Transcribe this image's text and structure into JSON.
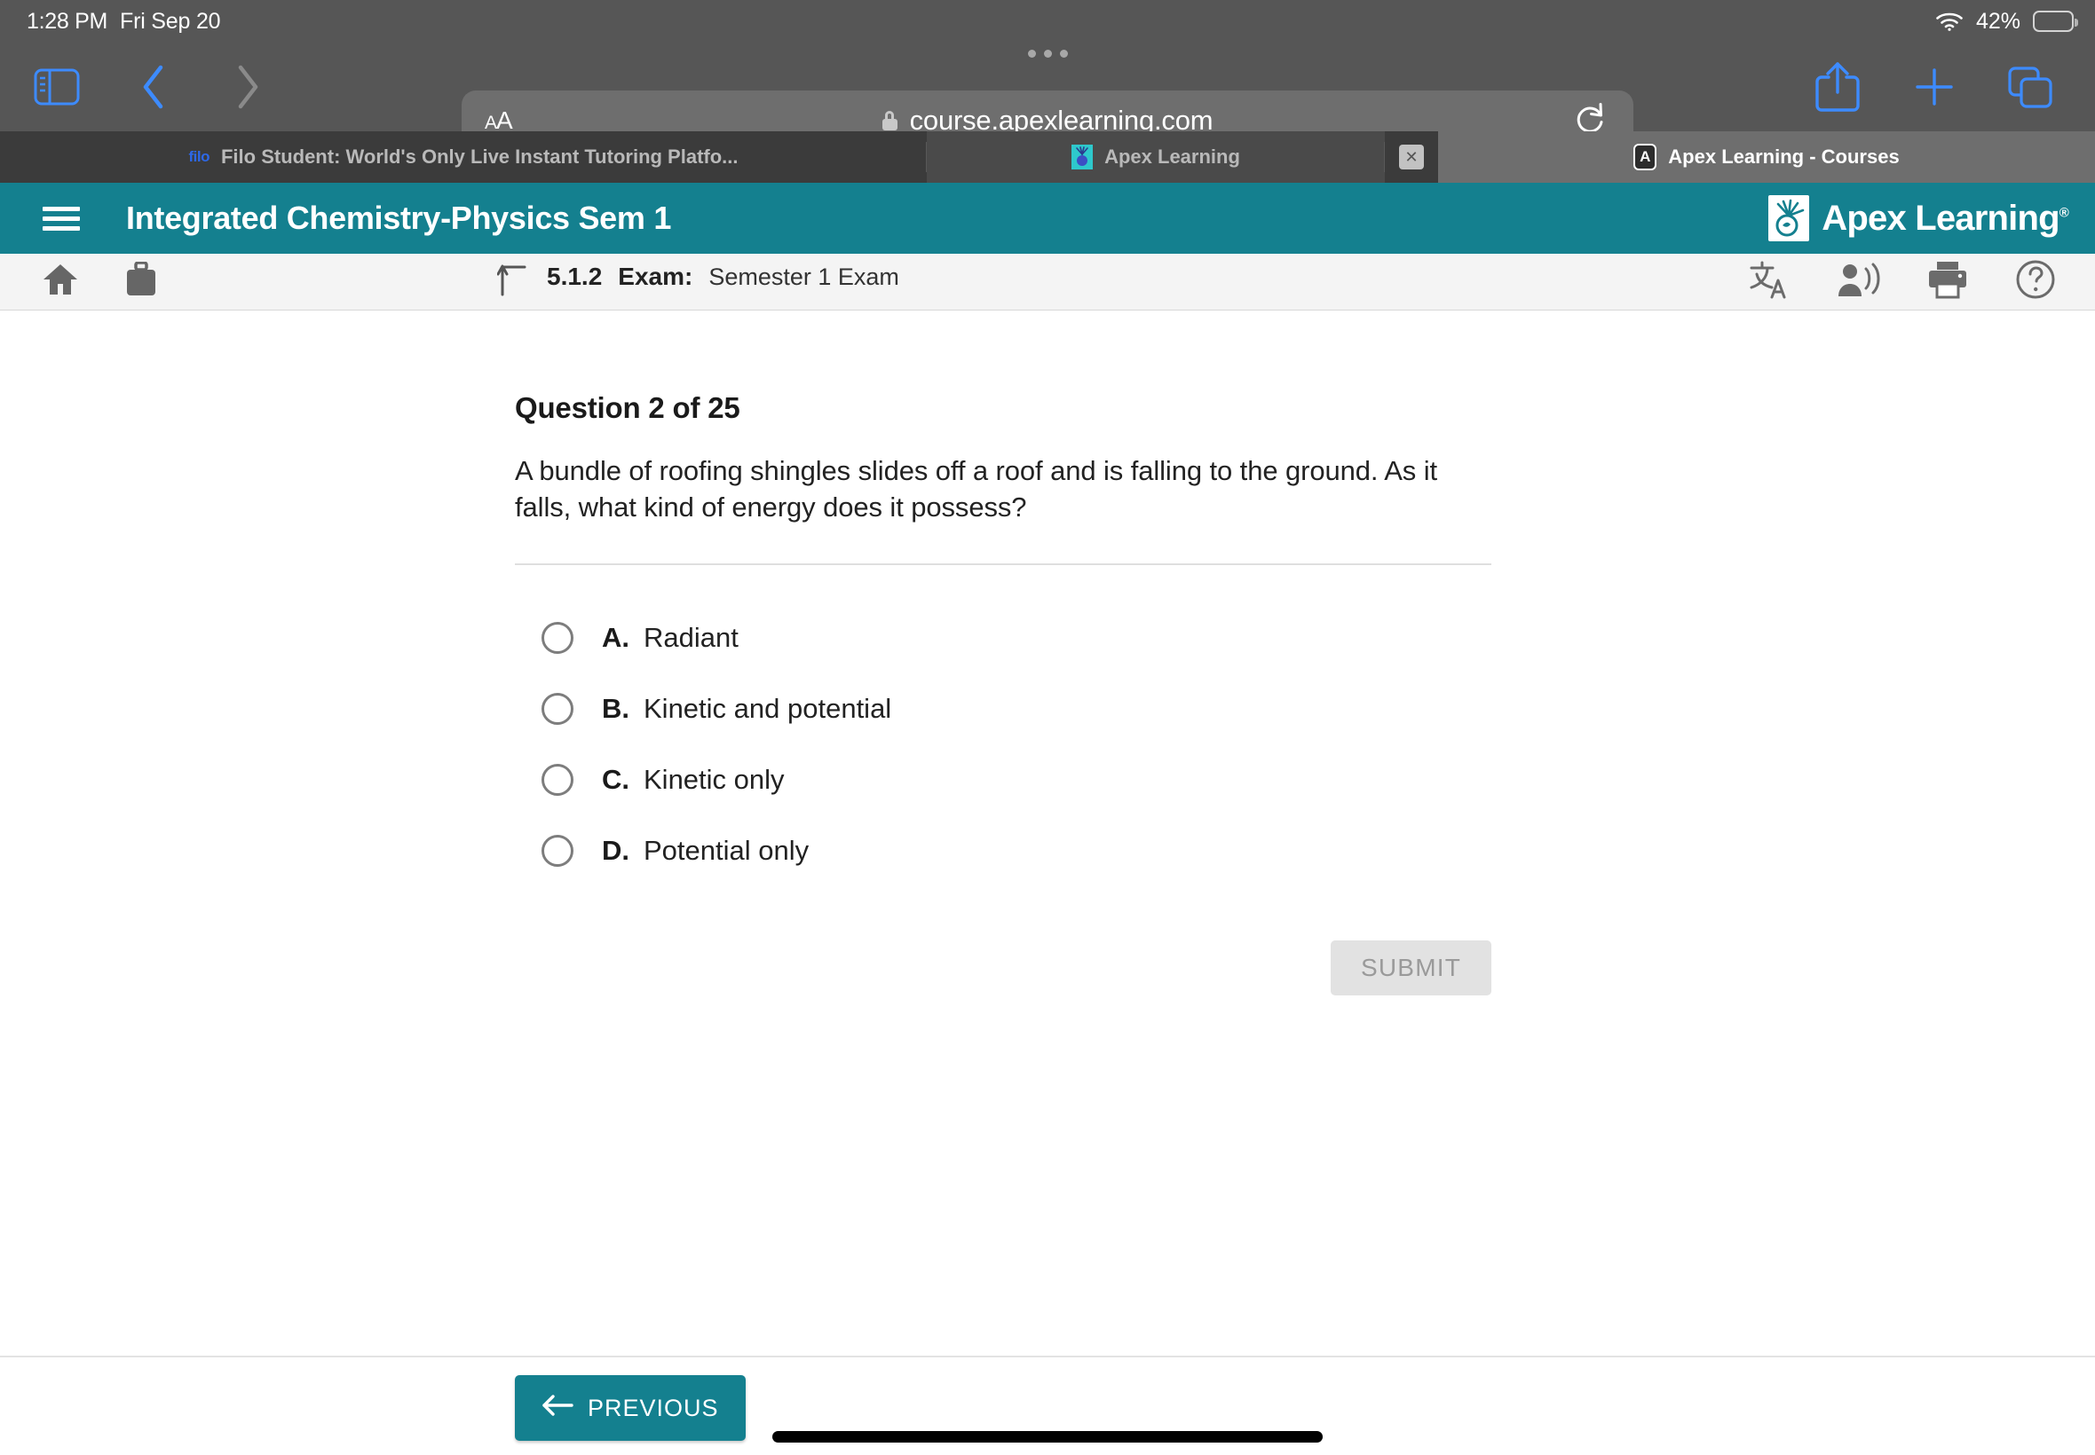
{
  "status_bar": {
    "time": "1:28 PM",
    "date": "Fri Sep 20",
    "battery_percent": "42%",
    "wifi_icon": "wifi-icon",
    "battery_icon": "battery-icon"
  },
  "browser": {
    "sidebar_icon": "sidebar-icon",
    "back_icon": "chevron-left-icon",
    "forward_icon": "chevron-right-icon",
    "text_size_label": "AA",
    "lock_icon": "lock-icon",
    "url": "course.apexlearning.com",
    "reload_icon": "reload-icon",
    "share_icon": "share-icon",
    "new_tab_icon": "plus-icon",
    "tab_overview_icon": "tabs-icon",
    "tabs": [
      {
        "favicon": "filo-favicon",
        "favicon_text": "filo",
        "label": "Filo Student: World's Only Live Instant Tutoring Platfo...",
        "active": false,
        "closable": false
      },
      {
        "favicon": "apex-favicon",
        "favicon_text": "",
        "label": "Apex Learning",
        "active": false,
        "closable": true,
        "close_label": "✕"
      },
      {
        "favicon": "apex-a-favicon",
        "favicon_text": "A",
        "label": "Apex Learning - Courses",
        "active": true,
        "closable": false
      }
    ]
  },
  "apex_header": {
    "menu_icon": "hamburger-menu-icon",
    "course_title": "Integrated Chemistry-Physics Sem 1",
    "brand_name": "Apex Learning",
    "brand_registered": "®",
    "brand_icon": "apex-lightbulb-logo",
    "background_color": "#14808f"
  },
  "sub_toolbar": {
    "home_icon": "home-icon",
    "briefcase_icon": "briefcase-icon",
    "up_icon": "up-level-arrow-icon",
    "lesson_number": "5.1.2",
    "lesson_kind": "Exam:",
    "lesson_name": "Semester 1 Exam",
    "translate_icon": "translate-icon",
    "read_aloud_icon": "read-aloud-icon",
    "print_icon": "print-icon",
    "help_icon": "help-icon"
  },
  "question": {
    "heading": "Question 2 of 25",
    "text": "A bundle of roofing shingles slides off a roof and is falling to the ground. As it falls, what kind of energy does it possess?",
    "options": [
      {
        "letter": "A.",
        "text": "Radiant",
        "selected": false
      },
      {
        "letter": "B.",
        "text": "Kinetic and potential",
        "selected": false
      },
      {
        "letter": "C.",
        "text": "Kinetic only",
        "selected": false
      },
      {
        "letter": "D.",
        "text": "Potential only",
        "selected": false
      }
    ],
    "submit_label": "SUBMIT",
    "submit_enabled": false
  },
  "footer": {
    "previous_label": "PREVIOUS",
    "previous_icon": "arrow-left-icon",
    "accent_color": "#14808f"
  }
}
